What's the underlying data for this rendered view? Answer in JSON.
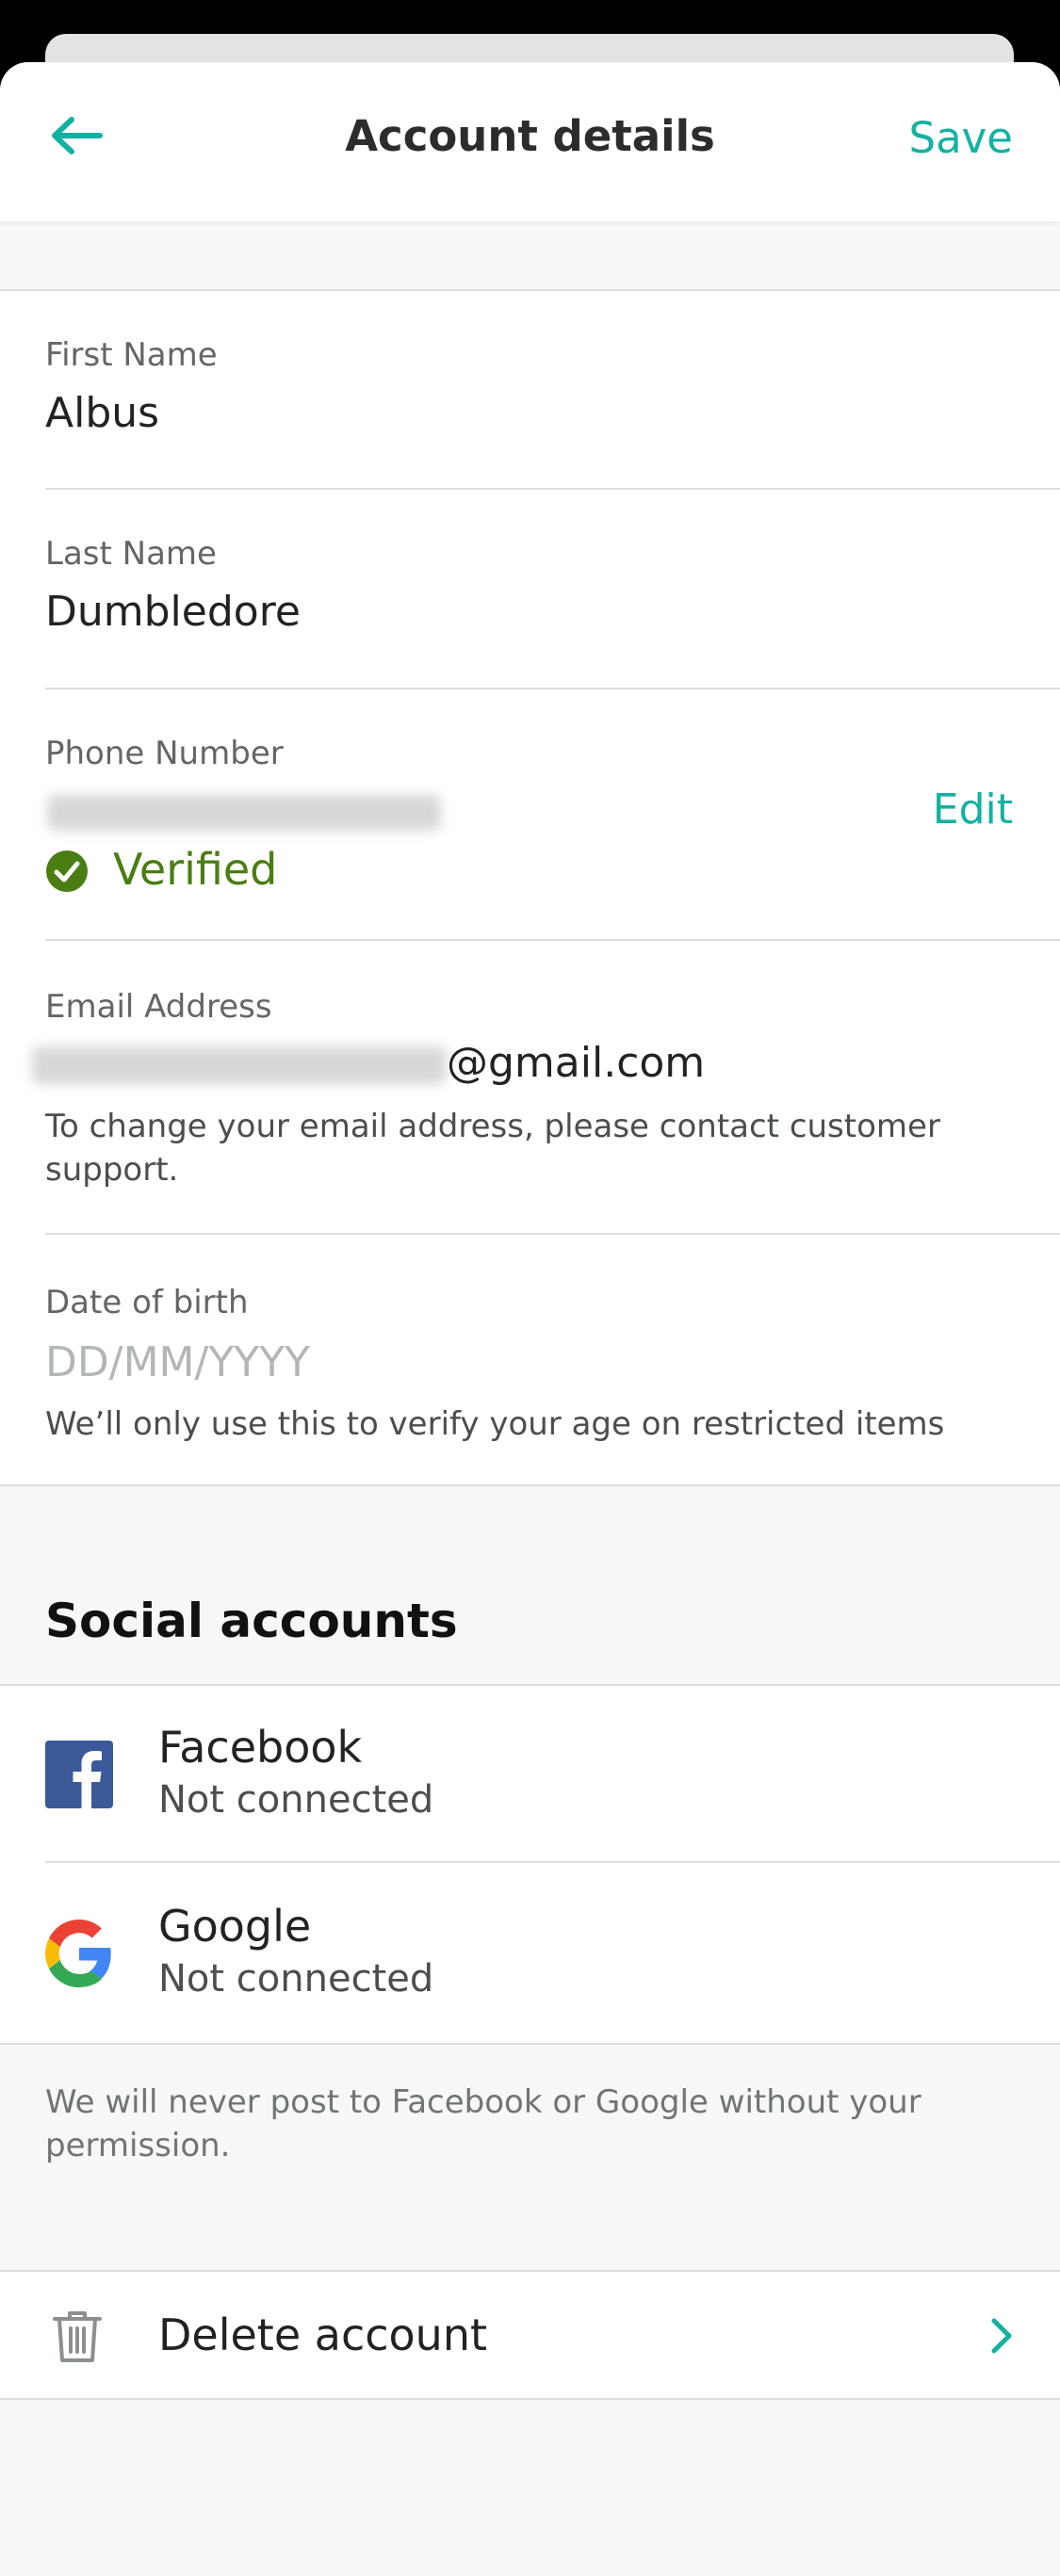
{
  "header": {
    "title": "Account details",
    "save_label": "Save"
  },
  "fields": {
    "first_name": {
      "label": "First Name",
      "value": "Albus"
    },
    "last_name": {
      "label": "Last Name",
      "value": "Dumbledore"
    },
    "phone": {
      "label": "Phone Number",
      "edit_label": "Edit",
      "verified_label": "Verified"
    },
    "email": {
      "label": "Email Address",
      "value_suffix": "@gmail.com",
      "help": "To change your email address, please contact customer support."
    },
    "dob": {
      "label": "Date of birth",
      "placeholder": "DD/MM/YYYY",
      "help": "We’ll only use this to verify your age on restricted items"
    }
  },
  "social": {
    "title": "Social accounts",
    "items": [
      {
        "name": "Facebook",
        "status": "Not connected",
        "icon": "facebook-icon"
      },
      {
        "name": "Google",
        "status": "Not connected",
        "icon": "google-icon"
      }
    ],
    "note": "We will never post to Facebook or Google without your permission."
  },
  "delete": {
    "label": "Delete account"
  },
  "colors": {
    "accent": "#13b1a2",
    "verified": "#4a7d12",
    "facebook": "#3b5998"
  }
}
